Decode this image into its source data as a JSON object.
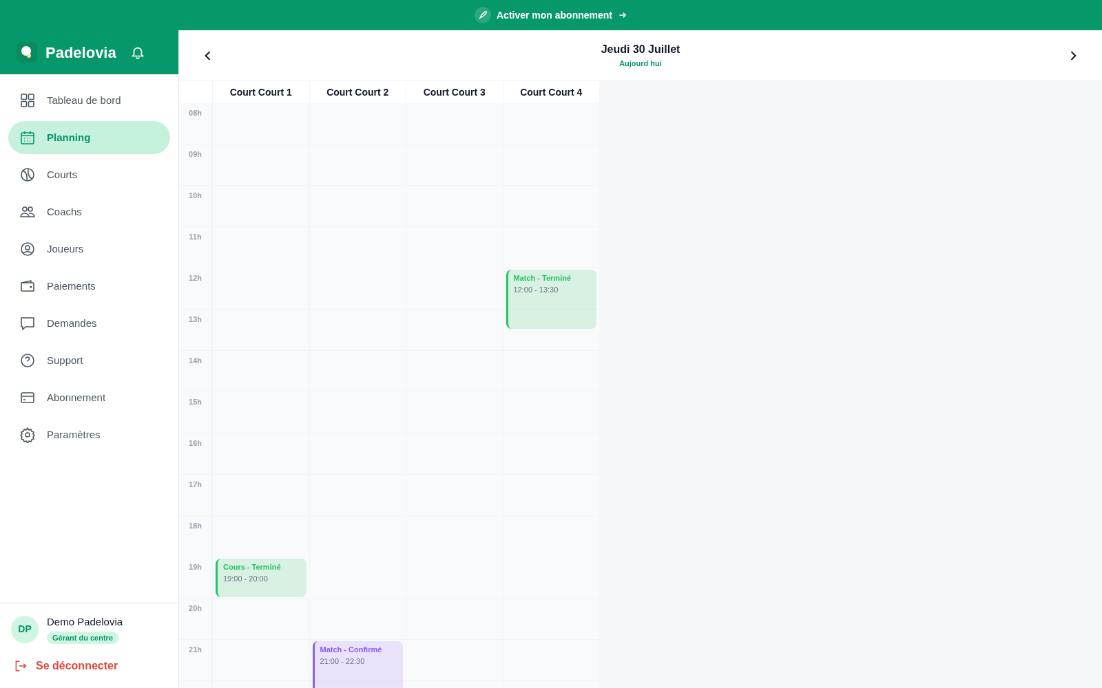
{
  "banner": {
    "label": "Activer mon abonnement"
  },
  "brand": {
    "name": "Padelovia"
  },
  "nav": [
    {
      "label": "Tableau de bord",
      "selected": false
    },
    {
      "label": "Planning",
      "selected": true
    },
    {
      "label": "Courts",
      "selected": false
    },
    {
      "label": "Coachs",
      "selected": false
    },
    {
      "label": "Joueurs",
      "selected": false
    },
    {
      "label": "Paiements",
      "selected": false
    },
    {
      "label": "Demandes",
      "selected": false
    },
    {
      "label": "Support",
      "selected": false
    },
    {
      "label": "Abonnement",
      "selected": false
    },
    {
      "label": "Paramètres",
      "selected": false
    }
  ],
  "user": {
    "initials": "DP",
    "name": "Demo Padelovia",
    "role": "Gérant du centre"
  },
  "logout": {
    "label": "Se déconnecter"
  },
  "calendar": {
    "date": "Jeudi 30 Juillet",
    "subtitle": "Aujourd hui",
    "hours": [
      "08h",
      "09h",
      "10h",
      "11h",
      "12h",
      "13h",
      "14h",
      "15h",
      "16h",
      "17h",
      "18h",
      "19h",
      "20h",
      "21h"
    ],
    "columns": [
      {
        "label": "Court Court 1",
        "events": [
          {
            "title": "Cours - Terminé",
            "time": "19:00 - 20:00",
            "color": "#22c55e"
          }
        ]
      },
      {
        "label": "Court Court 2",
        "events": [
          {
            "title": "Match - Confirmé",
            "time": "21:00 - 22:30",
            "color": "#8b5cf6"
          }
        ]
      },
      {
        "label": "Court Court 3"
      },
      {
        "label": "Court Court 4",
        "events": [
          {
            "title": "Match - Terminé",
            "time": "12:00 - 13:30",
            "color": "#22c55e"
          }
        ]
      }
    ]
  }
}
